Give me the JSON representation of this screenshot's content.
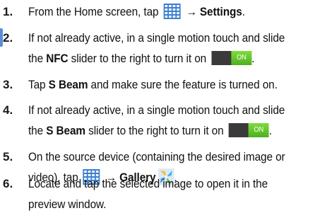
{
  "steps": [
    {
      "number": "1.",
      "line1_a": "From the Home screen, tap",
      "arrow": "→",
      "line1_b": "Settings",
      "line1_c": "."
    },
    {
      "number": "2.",
      "line1": "If not already active, in a single motion touch and slide",
      "line2_a": "the",
      "line2_b": "NFC",
      "line2_c": "slider to the right to turn it on",
      "toggle_label": "ON",
      "line2_d": "."
    },
    {
      "number": "3.",
      "line1_a": "Tap",
      "line1_b": "S Beam",
      "line1_c": "and make sure the feature is turned on."
    },
    {
      "number": "4.",
      "line1": "If not already active, in a single motion touch and slide",
      "line2_a": "the",
      "line2_b": "S Beam",
      "line2_c": "slider to the right to turn it on",
      "toggle_label": "ON",
      "line2_d": "."
    },
    {
      "number": "5.",
      "line1": "On the source device (containing the desired image or",
      "line2_a": "video), tap",
      "arrow": "→",
      "line2_b": "Gallery",
      "line2_c": "."
    },
    {
      "number": "6.",
      "line1": "Locate and tap the selected image to open it in the",
      "line2": "preview window."
    }
  ],
  "icons": {
    "apps": "apps-grid-icon",
    "gallery": "gallery-icon"
  },
  "colors": {
    "apps_icon": "#3b7fd1",
    "toggle_on": "#5cc52a",
    "toggle_track": "#3a3a3a"
  }
}
